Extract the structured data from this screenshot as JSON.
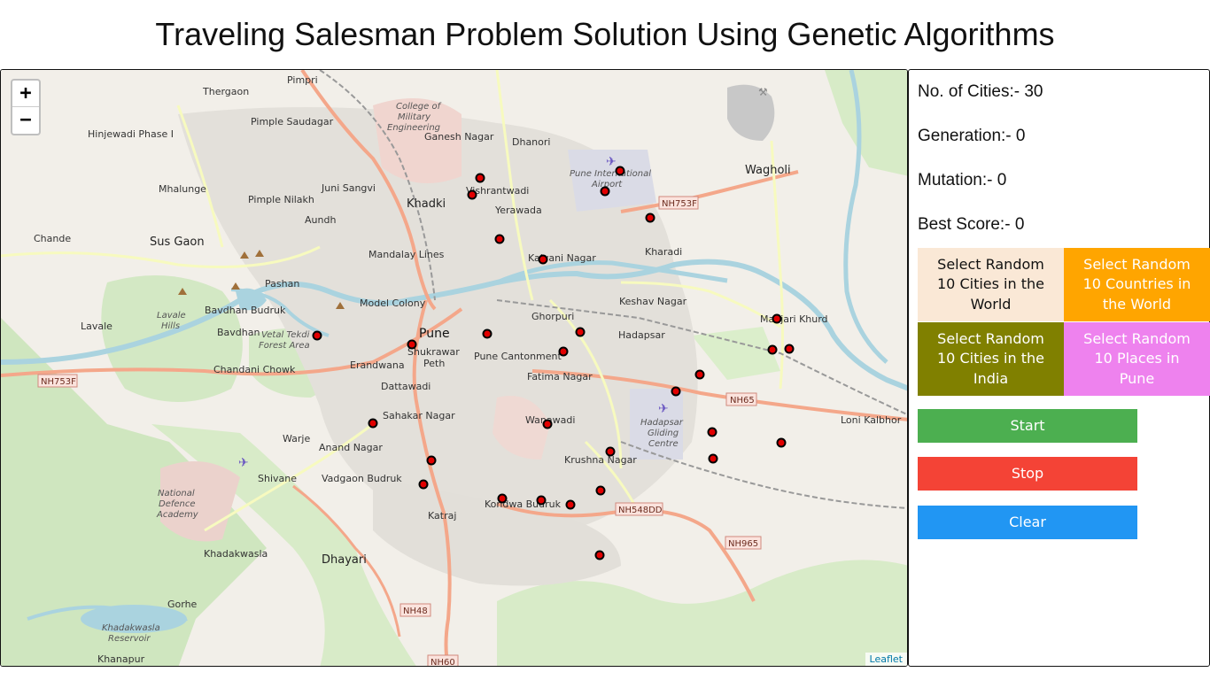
{
  "page": {
    "title": "Traveling Salesman Problem Solution Using Genetic Algorithms"
  },
  "map": {
    "zoom_in": "+",
    "zoom_out": "−",
    "attribution": "Leaflet",
    "labels": {
      "pimpri": "Pimpri",
      "thergaon": "Thergaon",
      "pimple_saudagar": "Pimple Saudagar",
      "hinjewadi": "Hinjewadi Phase I",
      "college_1": "College of",
      "college_2": "Military",
      "college_3": "Engineering",
      "ganesh_nagar": "Ganesh Nagar",
      "dhanori": "Dhanori",
      "airport_1": "Pune International",
      "airport_2": "Airport",
      "wagholi": "Wagholi",
      "mhalunge": "Mhalunge",
      "juni_sangvi": "Juni Sangvi",
      "pimple_nilakh": "Pimple Nilakh",
      "khadki": "Khadki",
      "vishrantwadi": "Vishrantwadi",
      "yerawada": "Yerawada",
      "nh753f_top": "NH753F",
      "chande": "Chande",
      "sus_gaon": "Sus Gaon",
      "aundh": "Aundh",
      "kharadi": "Kharadi",
      "mandalay_lines": "Mandalay Lines",
      "kalyani_nagar": "Kalyani Nagar",
      "pashan": "Pashan",
      "keshav_nagar": "Keshav Nagar",
      "model_colony": "Model Colony",
      "lavale_hills_1": "Lavale",
      "lavale_hills_2": "Hills",
      "bavdhan_budruk": "Bavdhan Budruk",
      "ghorpuri": "Ghorpuri",
      "manjari_khurd": "Manjari Khurd",
      "lavale": "Lavale",
      "bavdhan": "Bavdhan",
      "vetal_1": "Vetal Tekdi",
      "vetal_2": "Forest Area",
      "pune": "Pune",
      "hadapsar": "Hadapsar",
      "shukrawar_1": "Shukrawar",
      "shukrawar_2": "Peth",
      "pune_cantonment": "Pune Cantonment",
      "chandani_chowk": "Chandani Chowk",
      "erandwana": "Erandwana",
      "nh753f_left": "NH753F",
      "fatima_nagar": "Fatima Nagar",
      "dattawadi": "Dattawadi",
      "nh65": "NH65",
      "sahakar_nagar": "Sahakar Nagar",
      "wanawadi": "Wanawadi",
      "gliding_1": "Hadapsar",
      "gliding_2": "Gliding",
      "gliding_3": "Centre",
      "loni_kalbhor": "Loni Kalbhor",
      "warje": "Warje",
      "anand_nagar": "Anand Nagar",
      "krushna_nagar": "Krushna Nagar",
      "shivane": "Shivane",
      "vadgaon_budruk": "Vadgaon Budruk",
      "nda_1": "National",
      "nda_2": "Defence",
      "nda_3": "Academy",
      "katraj": "Katraj",
      "kondwa_budruk": "Kondwa Budruk",
      "nh548dd": "NH548DD",
      "nh965": "NH965",
      "khadakwasla": "Khadakwasla",
      "dhayari": "Dhayari",
      "gorhe": "Gorhe",
      "nh48": "NH48",
      "reservoir_1": "Khadakwasla",
      "reservoir_2": "Reservoir",
      "khanapur": "Khanapur",
      "nh60": "NH60"
    }
  },
  "stats": {
    "cities_label": "No. of Cities:- 30",
    "generation_label": "Generation:- 0",
    "mutation_label": "Mutation:- 0",
    "best_score_label": "Best Score:- 0"
  },
  "selectors": {
    "world_cities": "Select Random 10 Cities in the World",
    "world_countries": "Select Random 10 Countries in the World",
    "india_cities": "Select Random 10 Cities in the India",
    "pune_places": "Select Random 10 Places in Pune"
  },
  "actions": {
    "start": "Start",
    "stop": "Stop",
    "clear": "Clear"
  },
  "colors": {
    "marker_fill": "#e10000",
    "world_cities_bg": "#fae8d6",
    "world_countries_bg": "#ffa500",
    "india_cities_bg": "#808000",
    "pune_places_bg": "#ee82ee",
    "start_bg": "#4caf50",
    "stop_bg": "#f44336",
    "clear_bg": "#2196f3"
  },
  "cities_count": 30
}
